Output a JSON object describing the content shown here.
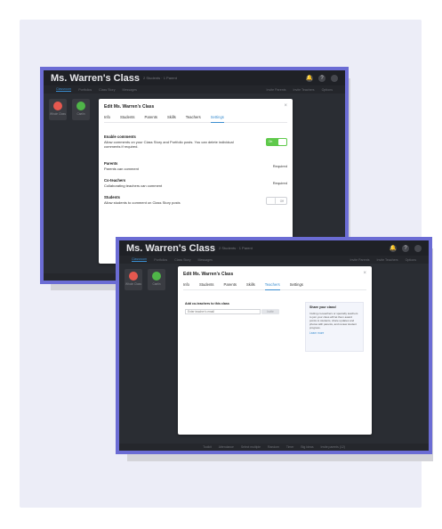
{
  "background_screen": {
    "class_name": "Ms. Warren's Class",
    "class_sub": "2 Students · 1 Parent",
    "tabs": [
      "Classroom",
      "Portfolios",
      "Class Story",
      "Messages"
    ],
    "active_tab": "Classroom",
    "right_links": [
      "Invite Parents",
      "Invite Teachers",
      "Options"
    ],
    "avatars": [
      {
        "label": "Whole Class",
        "color": "#e5584f"
      },
      {
        "label": "Caelin",
        "color": "#4fb548"
      }
    ],
    "bottom_items": [
      "Toolkit",
      "Attendance",
      "Select multiple",
      "Random",
      "Timer",
      "Big Ideas",
      "Invite parents (12)"
    ]
  },
  "settings_modal": {
    "title": "Edit Ms. Warren's Class",
    "close_glyph": "×",
    "tabs": [
      "Info",
      "Students",
      "Parents",
      "Skills",
      "Teachers",
      "Settings"
    ],
    "active_tab": "Settings",
    "enable_comments": {
      "title": "Enable comments",
      "description": "Allow comments on your Class Story and Portfolio posts. You can delete individual comments if required.",
      "toggle_label": "On"
    },
    "parents": {
      "title": "Parents",
      "description": "Parents can comment",
      "value": "Required"
    },
    "coteachers": {
      "title": "Co-teachers",
      "description": "Collaborating teachers can comment",
      "value": "Required"
    },
    "students": {
      "title": "Students",
      "description": "Allow students to comment on Class Story posts",
      "toggle_label": "Off"
    }
  },
  "teachers_modal": {
    "title": "Edit Ms. Warren's Class",
    "close_glyph": "×",
    "tabs": [
      "Info",
      "Students",
      "Parents",
      "Skills",
      "Teachers",
      "Settings"
    ],
    "active_tab": "Teachers",
    "add_label": "Add co-teachers to this class",
    "email_placeholder": "Enter teacher's email",
    "invite_button": "Invite",
    "share": {
      "title": "Share your class!",
      "text": "Inviting co-teachers or specialty teachers to join your class will let them award points to students, share updates and photos with parents, and review student progress.",
      "link": "Learn more"
    }
  },
  "colors": {
    "frame_accent": "#6b6cd4",
    "tab_active": "#3b8ed0",
    "toggle_on": "#5fc94b"
  }
}
